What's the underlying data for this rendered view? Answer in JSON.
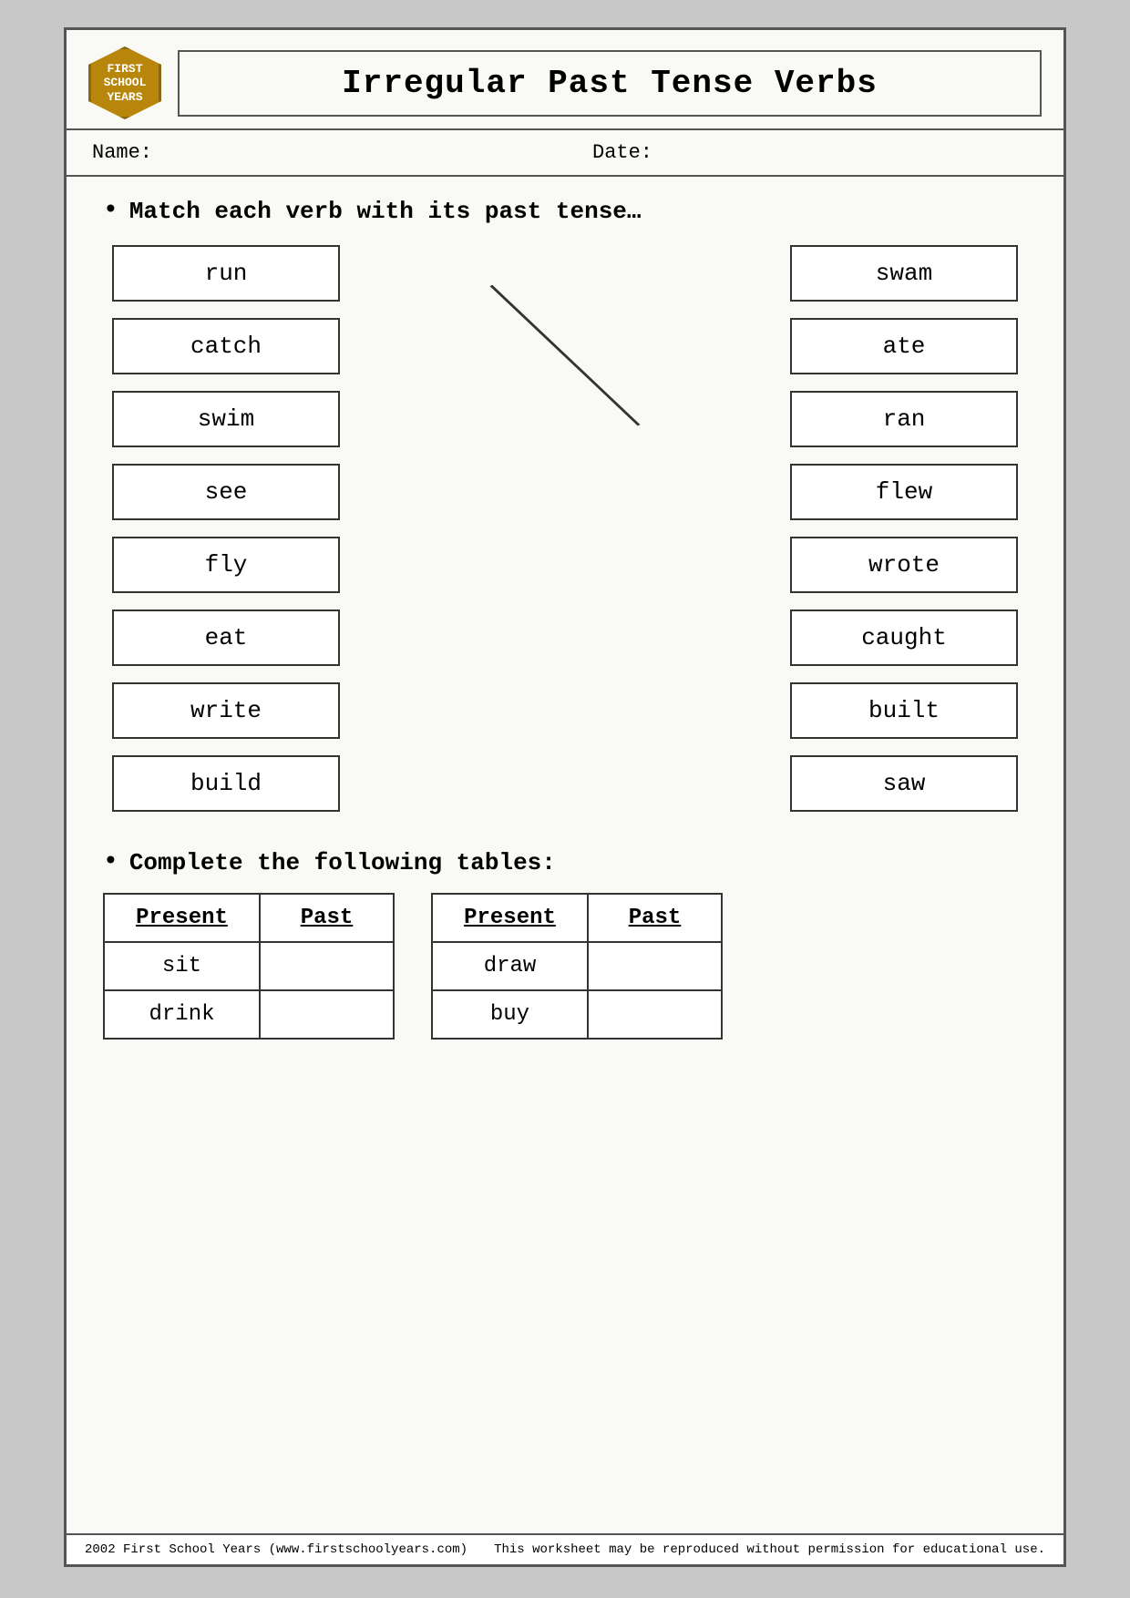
{
  "header": {
    "logo_line1": "FIRST",
    "logo_line2": "SCHOOL",
    "logo_line3": "YEARS",
    "title": "Irregular Past Tense Verbs"
  },
  "name_label": "Name:",
  "date_label": "Date:",
  "section1_instruction": "Match each verb with its past tense…",
  "left_verbs": [
    {
      "word": "run"
    },
    {
      "word": "catch"
    },
    {
      "word": "swim"
    },
    {
      "word": "see"
    },
    {
      "word": "fly"
    },
    {
      "word": "eat"
    },
    {
      "word": "write"
    },
    {
      "word": "build"
    }
  ],
  "right_verbs": [
    {
      "word": "swam"
    },
    {
      "word": "ate"
    },
    {
      "word": "ran"
    },
    {
      "word": "flew"
    },
    {
      "word": "wrote"
    },
    {
      "word": "caught"
    },
    {
      "word": "built"
    },
    {
      "word": "saw"
    }
  ],
  "section2_instruction": "Complete the following tables:",
  "table1": {
    "col1_header": "Present",
    "col2_header": "Past",
    "rows": [
      {
        "present": "sit",
        "past": ""
      },
      {
        "present": "drink",
        "past": ""
      }
    ]
  },
  "table2": {
    "col1_header": "Present",
    "col2_header": "Past",
    "rows": [
      {
        "present": "draw",
        "past": ""
      },
      {
        "present": "buy",
        "past": ""
      }
    ]
  },
  "footer_left": "2002 First School Years  (www.firstschoolyears.com)",
  "footer_right": "This worksheet may be reproduced without permission for educational use."
}
